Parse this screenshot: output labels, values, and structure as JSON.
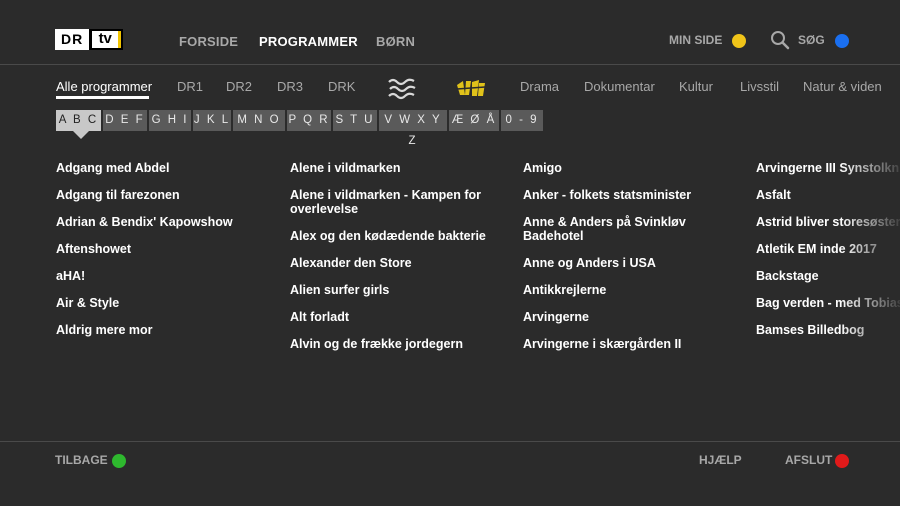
{
  "header": {
    "logo_dr": "DR",
    "logo_tv": "tv",
    "nav": [
      "FORSIDE",
      "PROGRAMMER",
      "BØRN"
    ],
    "min_side": "MIN SIDE",
    "search": "SØG"
  },
  "categories": [
    "Alle programmer",
    "DR1",
    "DR2",
    "DR3",
    "DRK",
    "Drama",
    "Dokumentar",
    "Kultur",
    "Livsstil",
    "Natur & viden"
  ],
  "channel_logos": {
    "ramasjang": "Ramasjang",
    "ultra": "ULTRA"
  },
  "letters": [
    "A B C",
    "D E F",
    "G H I",
    "J K L",
    "M N O",
    "P Q R",
    "S T U",
    "V W X Y Z",
    "Æ Ø Å",
    "0 - 9"
  ],
  "columns": [
    [
      "Adgang med Abdel",
      "Adgang til farezonen",
      "Adrian & Bendix' Kapowshow",
      "Aftenshowet",
      "aHA!",
      "Air & Style",
      "Aldrig mere mor"
    ],
    [
      "Alene i vildmarken",
      "Alene i vildmarken - Kampen for overlevelse",
      "Alex og den kødædende bakterie",
      "Alexander den Store",
      "Alien surfer girls",
      "Alt forladt",
      "Alvin og de frække jordegern"
    ],
    [
      "Amigo",
      "Anker - folkets statsminister",
      "Anne & Anders på Svinkløv Badehotel",
      "Anne og Anders i USA",
      "Antikkrejlerne",
      "Arvingerne",
      "Arvingerne i skærgården II"
    ],
    [
      "Arvingerne III Synstolkning",
      "Asfalt",
      "Astrid bliver storesøster",
      "Atletik EM inde 2017",
      "Backstage",
      "Bag verden - med Tobias",
      "Bamses Billedbog"
    ]
  ],
  "footer": {
    "back": "TILBAGE",
    "help": "HJÆLP",
    "exit": "AFSLUT"
  },
  "colors": {
    "yellow": "#f0c419",
    "blue": "#1a6ff0",
    "green": "#2eb82e",
    "red": "#e01a1a"
  }
}
